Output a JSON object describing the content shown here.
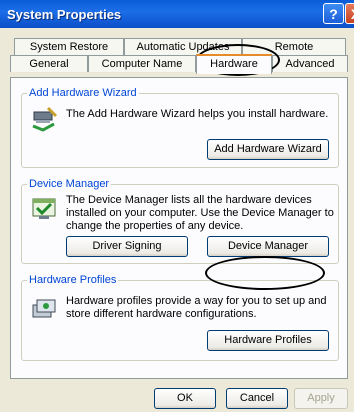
{
  "window": {
    "title": "System Properties",
    "help_glyph": "?",
    "close_glyph": "X"
  },
  "tabs_row1": [
    "System Restore",
    "Automatic Updates",
    "Remote"
  ],
  "tabs_row2": [
    "General",
    "Computer Name",
    "Hardware",
    "Advanced"
  ],
  "add_hardware": {
    "title": "Add Hardware Wizard",
    "text": "The Add Hardware Wizard helps you install hardware.",
    "button": "Add Hardware Wizard",
    "icon": "add-hardware-wizard-icon"
  },
  "device_manager": {
    "title": "Device Manager",
    "text": "The Device Manager lists all the hardware devices installed on your computer. Use the Device Manager to change the properties of any device.",
    "driver_button": "Driver Signing",
    "manager_button": "Device Manager",
    "icon": "device-manager-icon"
  },
  "hardware_profiles": {
    "title": "Hardware Profiles",
    "text": "Hardware profiles provide a way for you to set up and store different hardware configurations.",
    "button": "Hardware Profiles",
    "icon": "hardware-profiles-icon"
  },
  "footer": {
    "ok": "OK",
    "cancel": "Cancel",
    "apply": "Apply"
  },
  "colors": {
    "titlebar": "#0a5bd6",
    "group_title": "#0046d5",
    "dialog_bg": "#ece9d8",
    "annotation": "#000000"
  }
}
